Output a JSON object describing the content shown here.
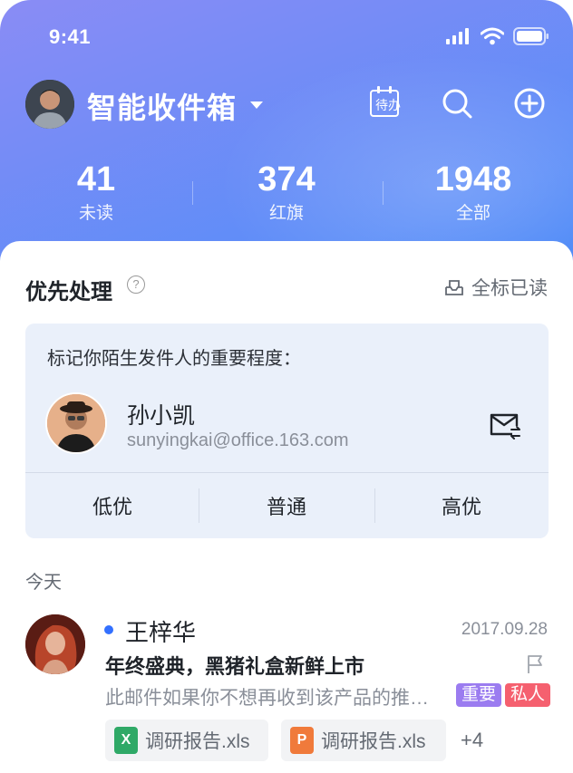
{
  "status_bar": {
    "time": "9:41"
  },
  "header": {
    "title": "智能收件箱",
    "todo_label": "待办"
  },
  "stats": [
    {
      "value": "41",
      "label": "未读"
    },
    {
      "value": "374",
      "label": "红旗"
    },
    {
      "value": "1948",
      "label": "全部"
    }
  ],
  "priority_section": {
    "title": "优先处理",
    "help_symbol": "?",
    "mark_all_label": "全标已读",
    "prompt": "标记你陌生发件人的重要程度：",
    "sender": {
      "name": "孙小凯",
      "email": "sunyingkai@office.163.com"
    },
    "options": [
      "低优",
      "普通",
      "高优"
    ]
  },
  "group_label": "今天",
  "mail": {
    "from": "王梓华",
    "date": "2017.09.28",
    "subject": "年终盛典，黑猪礼盒新鲜上市",
    "preview": "此邮件如果你不想再收到该产品的推送信息",
    "tags": [
      {
        "label": "重要",
        "color": "#9b7cf0"
      },
      {
        "label": "私人",
        "color": "#f5606f"
      }
    ],
    "attachments": [
      {
        "icon_letter": "X",
        "name": "调研报告.xls",
        "color": "#2fa967"
      },
      {
        "icon_letter": "P",
        "name": "调研报告.xls",
        "color": "#f07a3b"
      }
    ],
    "more_count": "+4"
  },
  "colors": {
    "accent": "#3370ff",
    "header_gradient_start": "#8a8cf5",
    "header_gradient_end": "#1f8ef0"
  }
}
